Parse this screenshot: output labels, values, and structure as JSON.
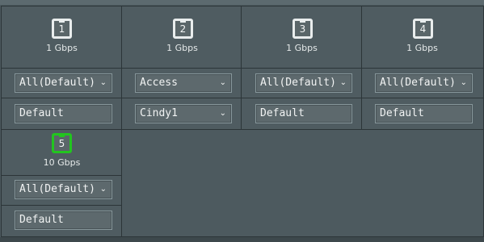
{
  "ports": [
    {
      "number": "1",
      "speed": "1 Gbps",
      "vlan_mode": "All(Default)",
      "profile": "Default",
      "active": false
    },
    {
      "number": "2",
      "speed": "1 Gbps",
      "vlan_mode": "Access",
      "profile": "Cindy1",
      "active": false
    },
    {
      "number": "3",
      "speed": "1 Gbps",
      "vlan_mode": "All(Default)",
      "profile": "Default",
      "active": false
    },
    {
      "number": "4",
      "speed": "1 Gbps",
      "vlan_mode": "All(Default)",
      "profile": "Default",
      "active": false
    },
    {
      "number": "5",
      "speed": "10 Gbps",
      "vlan_mode": "All(Default)",
      "profile": "Default",
      "active": true
    }
  ],
  "icons": {
    "port": "ethernet-port-icon",
    "dropdown": "chevron-down-icon"
  },
  "colors": {
    "active_port": "#22c51f",
    "panel": "#4d5a5f",
    "grid": "#2c3538"
  }
}
